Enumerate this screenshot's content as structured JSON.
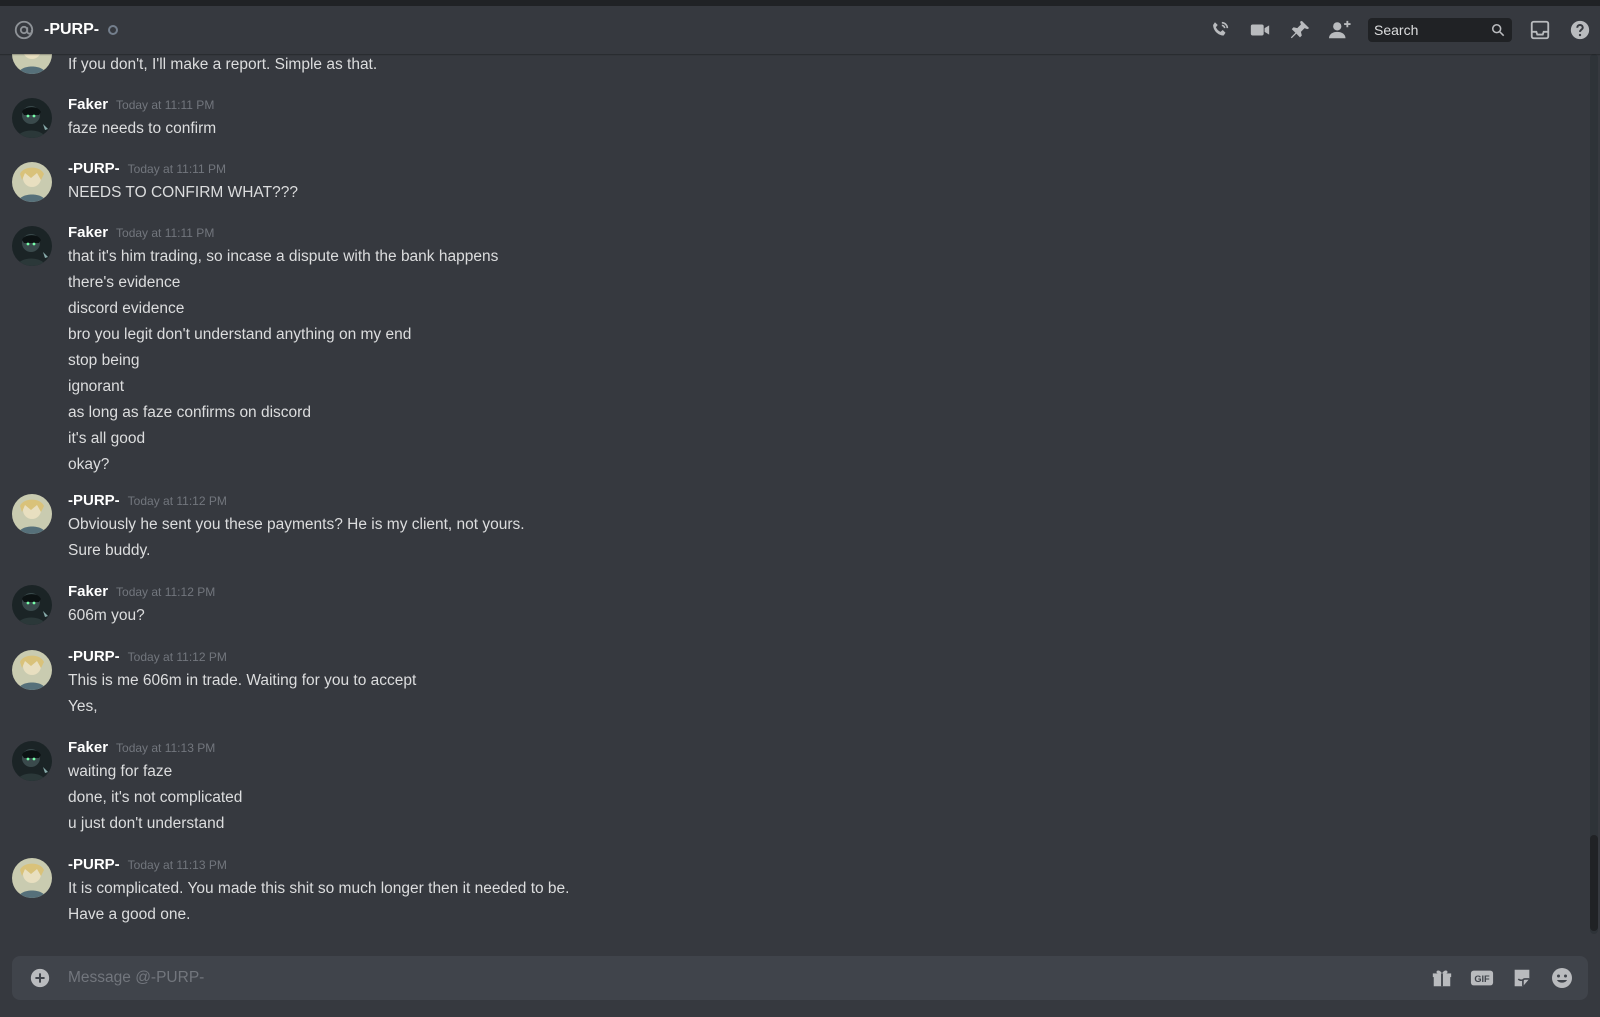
{
  "header": {
    "title": "-PURP-",
    "search_placeholder": "Search"
  },
  "composer": {
    "placeholder": "Message @-PURP-"
  },
  "partial_message": "If you don't, I'll make a report. Simple as that.",
  "groups": [
    {
      "author": "Faker",
      "timestamp": "Today at 11:11 PM",
      "lines": [
        "faze needs to confirm"
      ]
    },
    {
      "author": "-PURP-",
      "timestamp": "Today at 11:11 PM",
      "lines": [
        "NEEDS TO CONFIRM WHAT???"
      ]
    },
    {
      "author": "Faker",
      "timestamp": "Today at 11:11 PM",
      "lines": [
        "that it's him trading, so incase a dispute with the bank happens",
        "there's evidence",
        "discord evidence",
        "bro you legit don't understand anything on my end",
        "stop being",
        "ignorant",
        "as long as faze confirms on discord",
        "it's all good",
        "okay?"
      ]
    },
    {
      "author": "-PURP-",
      "timestamp": "Today at 11:12 PM",
      "lines": [
        "Obviously he sent you these payments? He is my client, not yours.",
        "Sure buddy."
      ]
    },
    {
      "author": "Faker",
      "timestamp": "Today at 11:12 PM",
      "lines": [
        "606m you?"
      ]
    },
    {
      "author": "-PURP-",
      "timestamp": "Today at 11:12 PM",
      "lines": [
        "This is me 606m in trade. Waiting for you to accept",
        "Yes,"
      ]
    },
    {
      "author": "Faker",
      "timestamp": "Today at 11:13 PM",
      "lines": [
        "waiting for faze",
        "done, it's not complicated",
        "u just don't understand"
      ]
    },
    {
      "author": "-PURP-",
      "timestamp": "Today at 11:13 PM",
      "lines": [
        "It is complicated. You made this shit so much longer then it needed to be.",
        "Have a good one."
      ]
    }
  ],
  "colors": {
    "background": "#36393f",
    "composer": "#40444b",
    "text": "#dcddde",
    "muted": "#72767d",
    "icon": "#b9bbbe"
  }
}
